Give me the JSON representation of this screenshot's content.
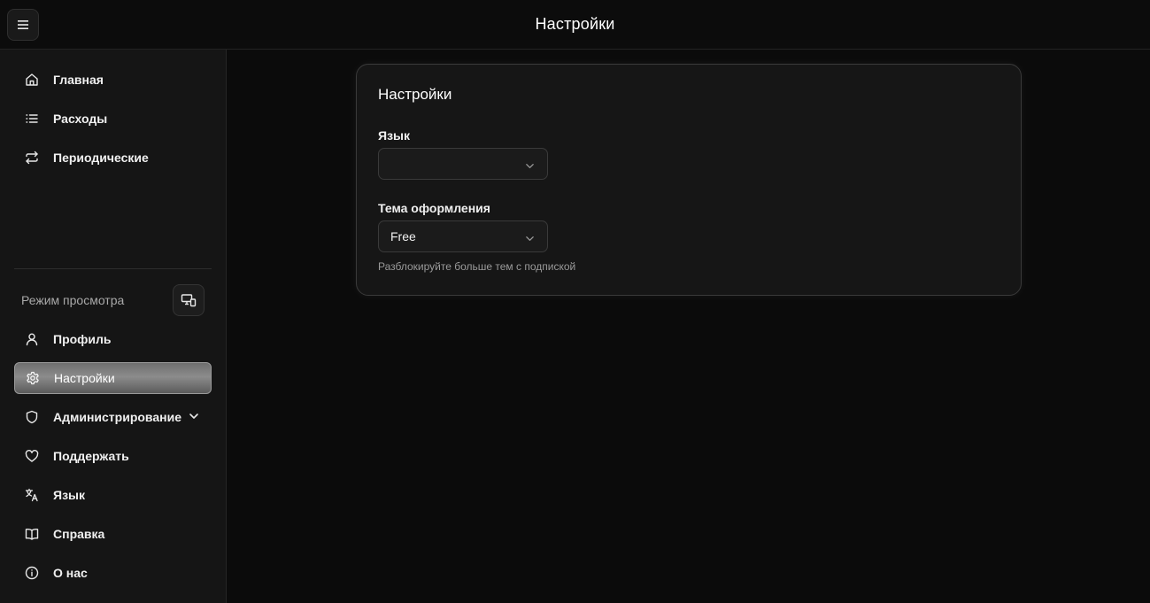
{
  "header": {
    "title": "Настройки",
    "menu_icon": "menu-icon"
  },
  "sidebar": {
    "top_items": [
      {
        "label": "Главная",
        "icon": "home-icon"
      },
      {
        "label": "Расходы",
        "icon": "list-icon"
      },
      {
        "label": "Периодические",
        "icon": "repeat-icon"
      }
    ],
    "view_mode_label": "Режим просмотра",
    "view_mode_icon": "device-toggle-icon",
    "bottom_items": [
      {
        "label": "Профиль",
        "icon": "user-icon"
      },
      {
        "label": "Настройки",
        "icon": "gear-icon",
        "active": true
      },
      {
        "label": "Администрирование",
        "icon": "shield-icon",
        "expandable": true
      },
      {
        "label": "Поддержать",
        "icon": "heart-icon"
      },
      {
        "label": "Язык",
        "icon": "translate-icon"
      },
      {
        "label": "Справка",
        "icon": "book-icon"
      },
      {
        "label": "О нас",
        "icon": "info-icon"
      }
    ]
  },
  "settings": {
    "title": "Настройки",
    "language": {
      "label": "Язык",
      "value": ""
    },
    "theme": {
      "label": "Тема оформления",
      "value": "Free",
      "hint": "Разблокируйте больше тем с подпиской"
    }
  },
  "colors": {
    "background": "#0b0b0b",
    "sidebar": "#151515",
    "card": "#161616",
    "active_item": "#7a7a7a"
  }
}
